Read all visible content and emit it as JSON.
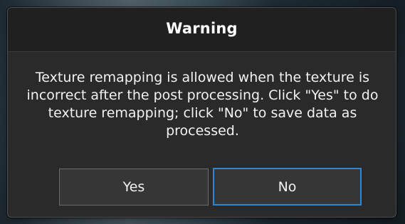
{
  "dialog": {
    "title": "Warning",
    "message": "Texture remapping is allowed when the texture is incorrect after the post processing. Click \"Yes\" to do texture remapping; click \"No\" to save data as processed.",
    "buttons": {
      "yes_label": "Yes",
      "no_label": "No"
    },
    "focused_button": "No",
    "accent_color": "#2f86d6"
  }
}
